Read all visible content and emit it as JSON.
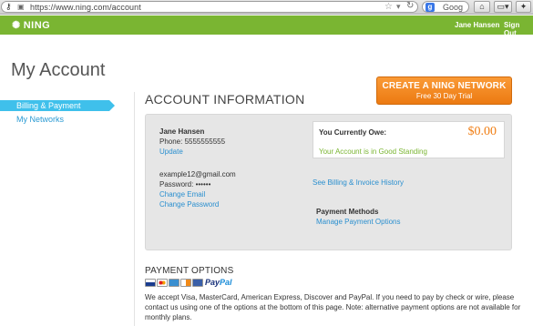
{
  "browser": {
    "url": "https://www.ning.com/account",
    "search_placeholder": "Goog"
  },
  "topbar": {
    "logo": "NING",
    "user_name": "Jane Hansen",
    "sign_out": "Sign Out"
  },
  "page": {
    "title": "My Account"
  },
  "sidebar": {
    "items": [
      {
        "label": "Billing & Payment",
        "active": true
      },
      {
        "label": "My Networks",
        "active": false
      }
    ]
  },
  "account": {
    "heading": "ACCOUNT INFORMATION",
    "create_button": "CREATE A NING NETWORK",
    "create_sub": "Free 30 Day Trial",
    "name": "Jane Hansen",
    "phone": "Phone: 5555555555",
    "update": "Update",
    "email": "example12@gmail.com",
    "password": "Password: ••••••",
    "change_email": "Change Email",
    "change_password": "Change Password",
    "owe_label": "You Currently Owe:",
    "owe_amount": "$0.00",
    "standing": "Your Account is in Good Standing",
    "billing_history": "See Billing & Invoice History",
    "payment_methods": "Payment Methods",
    "manage_payment": "Manage Payment Options"
  },
  "payment_options": {
    "heading": "PAYMENT OPTIONS",
    "paypal_a": "Pay",
    "paypal_b": "Pal",
    "text": "We accept Visa, MasterCard, American Express, Discover and PayPal. If you need to pay by check or wire, please contact us using one of the options at the bottom of this page. Note: alternative payment options are not available for monthly plans."
  },
  "colors": {
    "ning_green": "#7ab532",
    "accent_blue": "#3fc0eb",
    "link_blue": "#2a8fcf",
    "orange": "#f07e14"
  }
}
